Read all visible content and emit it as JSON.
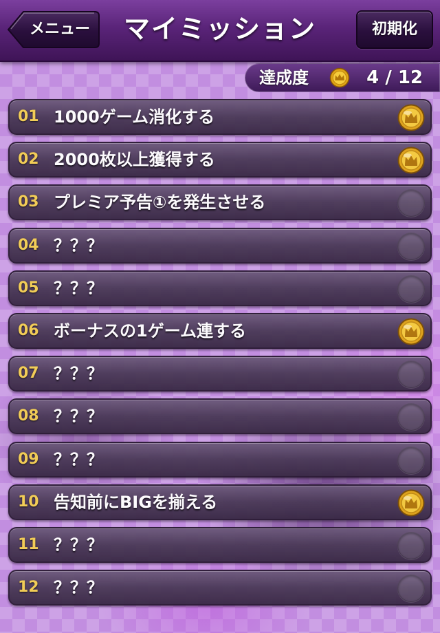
{
  "header": {
    "title": "マイミッション",
    "back_label": "メニュー",
    "reset_label": "初期化"
  },
  "progress": {
    "label": "達成度",
    "value": "4 / 12",
    "achieved": 4,
    "total": 12
  },
  "missions": [
    {
      "num": "01",
      "name": "1000ゲーム消化する",
      "achieved": true
    },
    {
      "num": "02",
      "name": "2000枚以上獲得する",
      "achieved": true
    },
    {
      "num": "03",
      "name": "プレミア予告①を発生させる",
      "achieved": false
    },
    {
      "num": "04",
      "name": "？？？",
      "achieved": false
    },
    {
      "num": "05",
      "name": "？？？",
      "achieved": false
    },
    {
      "num": "06",
      "name": "ボーナスの1ゲーム連する",
      "achieved": true
    },
    {
      "num": "07",
      "name": "？？？",
      "achieved": false
    },
    {
      "num": "08",
      "name": "？？？",
      "achieved": false
    },
    {
      "num": "09",
      "name": "？？？",
      "achieved": false
    },
    {
      "num": "10",
      "name": "告知前にBIGを揃える",
      "achieved": true
    },
    {
      "num": "11",
      "name": "？？？",
      "achieved": false
    },
    {
      "num": "12",
      "name": "？？？",
      "achieved": false
    }
  ],
  "icons": {
    "achieved": "gold-crown-coin-icon",
    "not_achieved": "empty-circle-icon"
  },
  "colors": {
    "mission_number": "#f4cf52",
    "header": "#5a2479",
    "coin": "#e0a416"
  }
}
